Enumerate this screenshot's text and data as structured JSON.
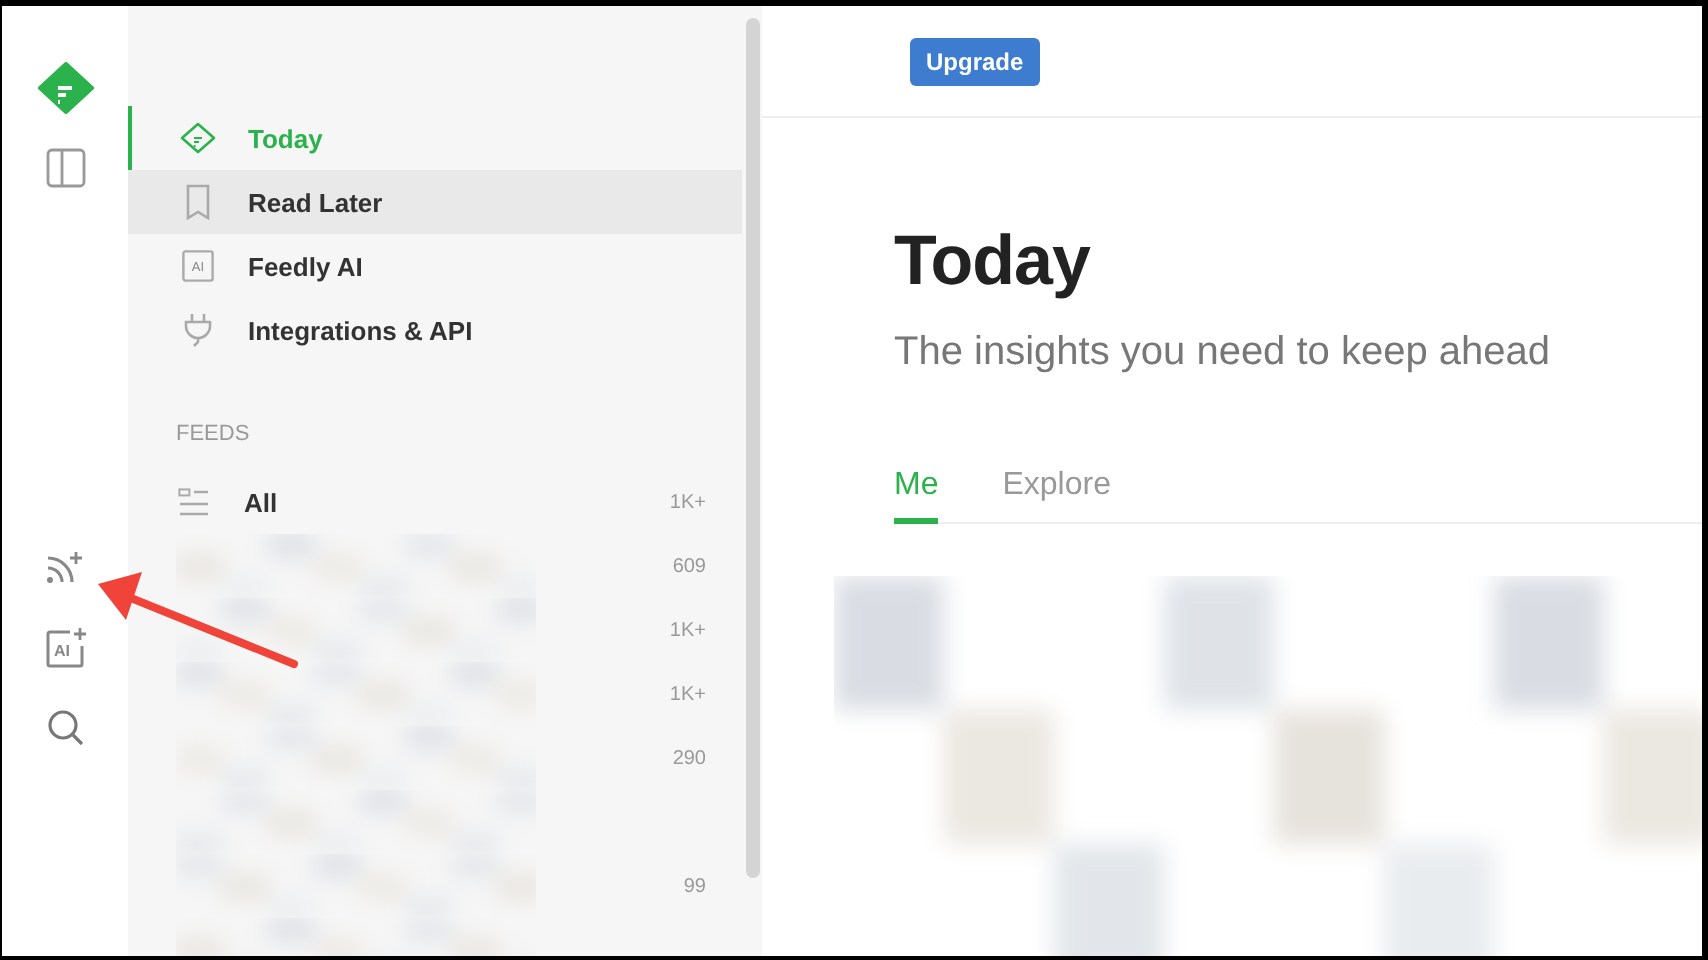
{
  "rail": [
    {
      "kind": "logo"
    },
    {
      "kind": "panel"
    },
    {
      "kind": "spacer"
    },
    {
      "kind": "add-feed"
    },
    {
      "kind": "add-ai",
      "badge": "AI"
    },
    {
      "kind": "search"
    }
  ],
  "nav": [
    {
      "kind": "today",
      "label": "Today",
      "selected": true,
      "highlighted": false
    },
    {
      "kind": "bookmark",
      "label": "Read Later",
      "selected": false,
      "highlighted": true
    },
    {
      "kind": "ai",
      "label": "Feedly AI",
      "icon_text": "AI",
      "selected": false,
      "highlighted": false
    },
    {
      "kind": "plug",
      "label": "Integrations & API",
      "selected": false,
      "highlighted": false
    }
  ],
  "feeds_heading": "FEEDS",
  "feeds": [
    {
      "kind": "all",
      "label": "All",
      "count": "1K+"
    },
    {
      "kind": "blurred",
      "count": "609"
    },
    {
      "kind": "blurred",
      "count": "1K+"
    },
    {
      "kind": "blurred",
      "count": "1K+"
    },
    {
      "kind": "blurred",
      "count": "290"
    },
    {
      "kind": "blurred"
    },
    {
      "kind": "blurred",
      "count": "99"
    },
    {
      "kind": "blurred"
    }
  ],
  "top_bar": {
    "button": "Upgrade"
  },
  "main": {
    "title": "Today",
    "subtitle": "The insights you need to keep ahead",
    "tabs": [
      {
        "label": "Me",
        "selected": true
      },
      {
        "label": "Explore",
        "selected": false
      }
    ],
    "content": {
      "kind": "blurred"
    }
  }
}
